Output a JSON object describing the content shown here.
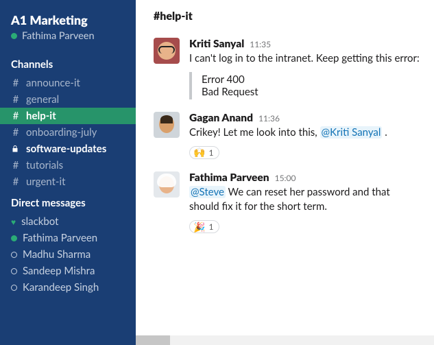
{
  "workspace": {
    "name": "A1 Marketing",
    "current_user": "Fathima Parveen"
  },
  "sections": {
    "channels": "Channels",
    "dms": "Direct messages"
  },
  "channels": [
    {
      "name": "announce-it",
      "prefix": "#",
      "active": false,
      "unread": false
    },
    {
      "name": "general",
      "prefix": "#",
      "active": false,
      "unread": false
    },
    {
      "name": "help-it",
      "prefix": "#",
      "active": true,
      "unread": true
    },
    {
      "name": "onboarding-july",
      "prefix": "#",
      "active": false,
      "unread": false
    },
    {
      "name": "software-updates",
      "prefix": "lock",
      "active": false,
      "unread": true
    },
    {
      "name": "tutorials",
      "prefix": "#",
      "active": false,
      "unread": false
    },
    {
      "name": "urgent-it",
      "prefix": "#",
      "active": false,
      "unread": false
    }
  ],
  "dms": [
    {
      "name": "slackbot",
      "presence": "heart"
    },
    {
      "name": "Fathima Parveen",
      "presence": "active"
    },
    {
      "name": "Madhu Sharma",
      "presence": "away"
    },
    {
      "name": "Sandeep Mishra",
      "presence": "away"
    },
    {
      "name": "Karandeep Singh",
      "presence": "away"
    }
  ],
  "channel_header": "#help-it",
  "messages": [
    {
      "author": "Kriti Sanyal",
      "time": "11:35",
      "text": "I can't log in to the intranet. Keep getting this error:",
      "quote": {
        "l1": "Error 400",
        "l2": "Bad Request"
      }
    },
    {
      "author": "Gagan Anand",
      "time": "11:36",
      "pre": "Crikey! Let me look into this, ",
      "mention": "@Kriti Sanyal",
      "post": " .",
      "reaction": {
        "emoji": "🙌",
        "count": "1"
      }
    },
    {
      "author": "Fathima Parveen",
      "time": "15:00",
      "mention": "@Steve",
      "post": " We can reset her password and that should fix it for the short term.",
      "reaction": {
        "emoji": "🎉",
        "count": "1"
      }
    }
  ]
}
